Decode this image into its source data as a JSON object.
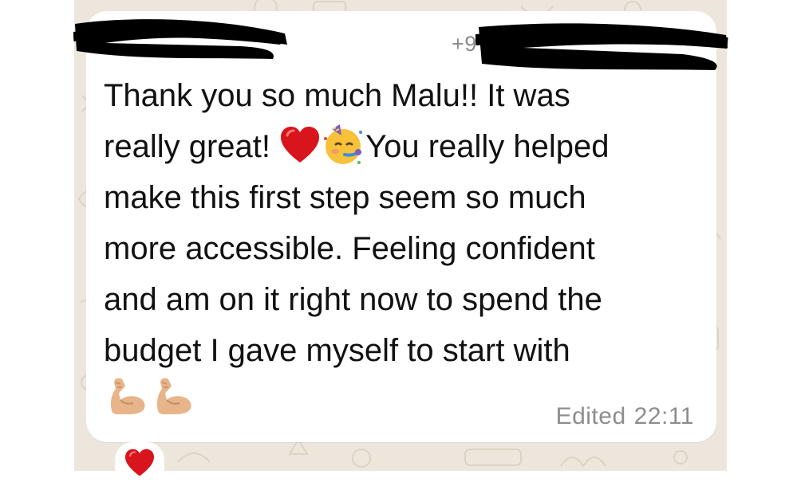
{
  "message": {
    "sender_name": "",
    "sender_phone": "+9",
    "text_line1": "Thank you so much Malu!! It was",
    "text_line2_start": "really great! ",
    "text_line2_end": "You really helped",
    "text_line3": "make this first step seem so much",
    "text_line4": "more accessible. Feeling confident",
    "text_line5": "and am on it right now to spend the",
    "text_line6": "budget I gave myself to start with",
    "inline_emojis": [
      "red-heart-icon",
      "partying-face-icon"
    ],
    "trailing_emojis": [
      "flexed-biceps-icon",
      "flexed-biceps-icon"
    ],
    "edited_label": "Edited",
    "time": "22:11"
  },
  "reaction": {
    "emoji": "red-heart-icon"
  },
  "colors": {
    "chat_background": "#ede6dc",
    "bubble": "#ffffff",
    "text": "#111111",
    "meta_text": "#8d8d8d",
    "redaction": "#000000"
  }
}
